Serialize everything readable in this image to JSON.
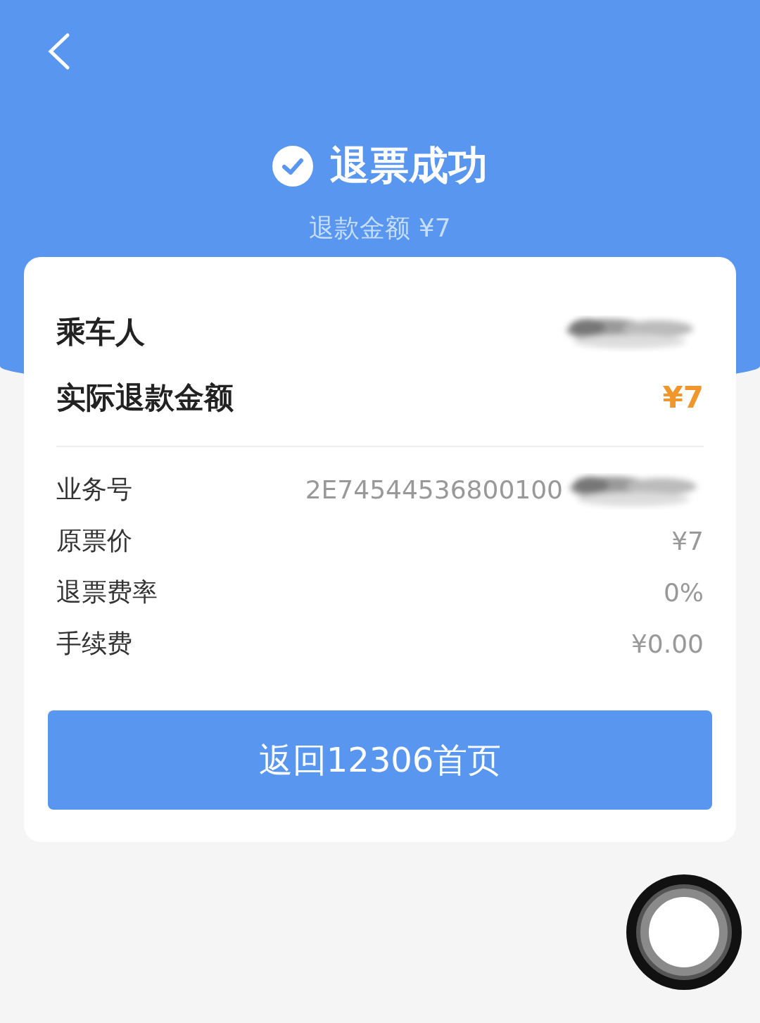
{
  "header": {
    "title": "退票成功",
    "subtitle": "退款金额 ¥7"
  },
  "summary": [
    {
      "kind": "redacted",
      "label": "乘车人"
    },
    {
      "kind": "amount",
      "label": "实际退款金额",
      "value": "¥7"
    }
  ],
  "details": [
    {
      "kind": "partly_redacted",
      "label": "业务号",
      "value": "2E74544536800100"
    },
    {
      "kind": "text",
      "label": "原票价",
      "value": "¥7"
    },
    {
      "kind": "text",
      "label": "退票费率",
      "value": "0%"
    },
    {
      "kind": "text",
      "label": "手续费",
      "value": "¥0.00"
    }
  ],
  "button": {
    "label": "返回12306首页"
  }
}
